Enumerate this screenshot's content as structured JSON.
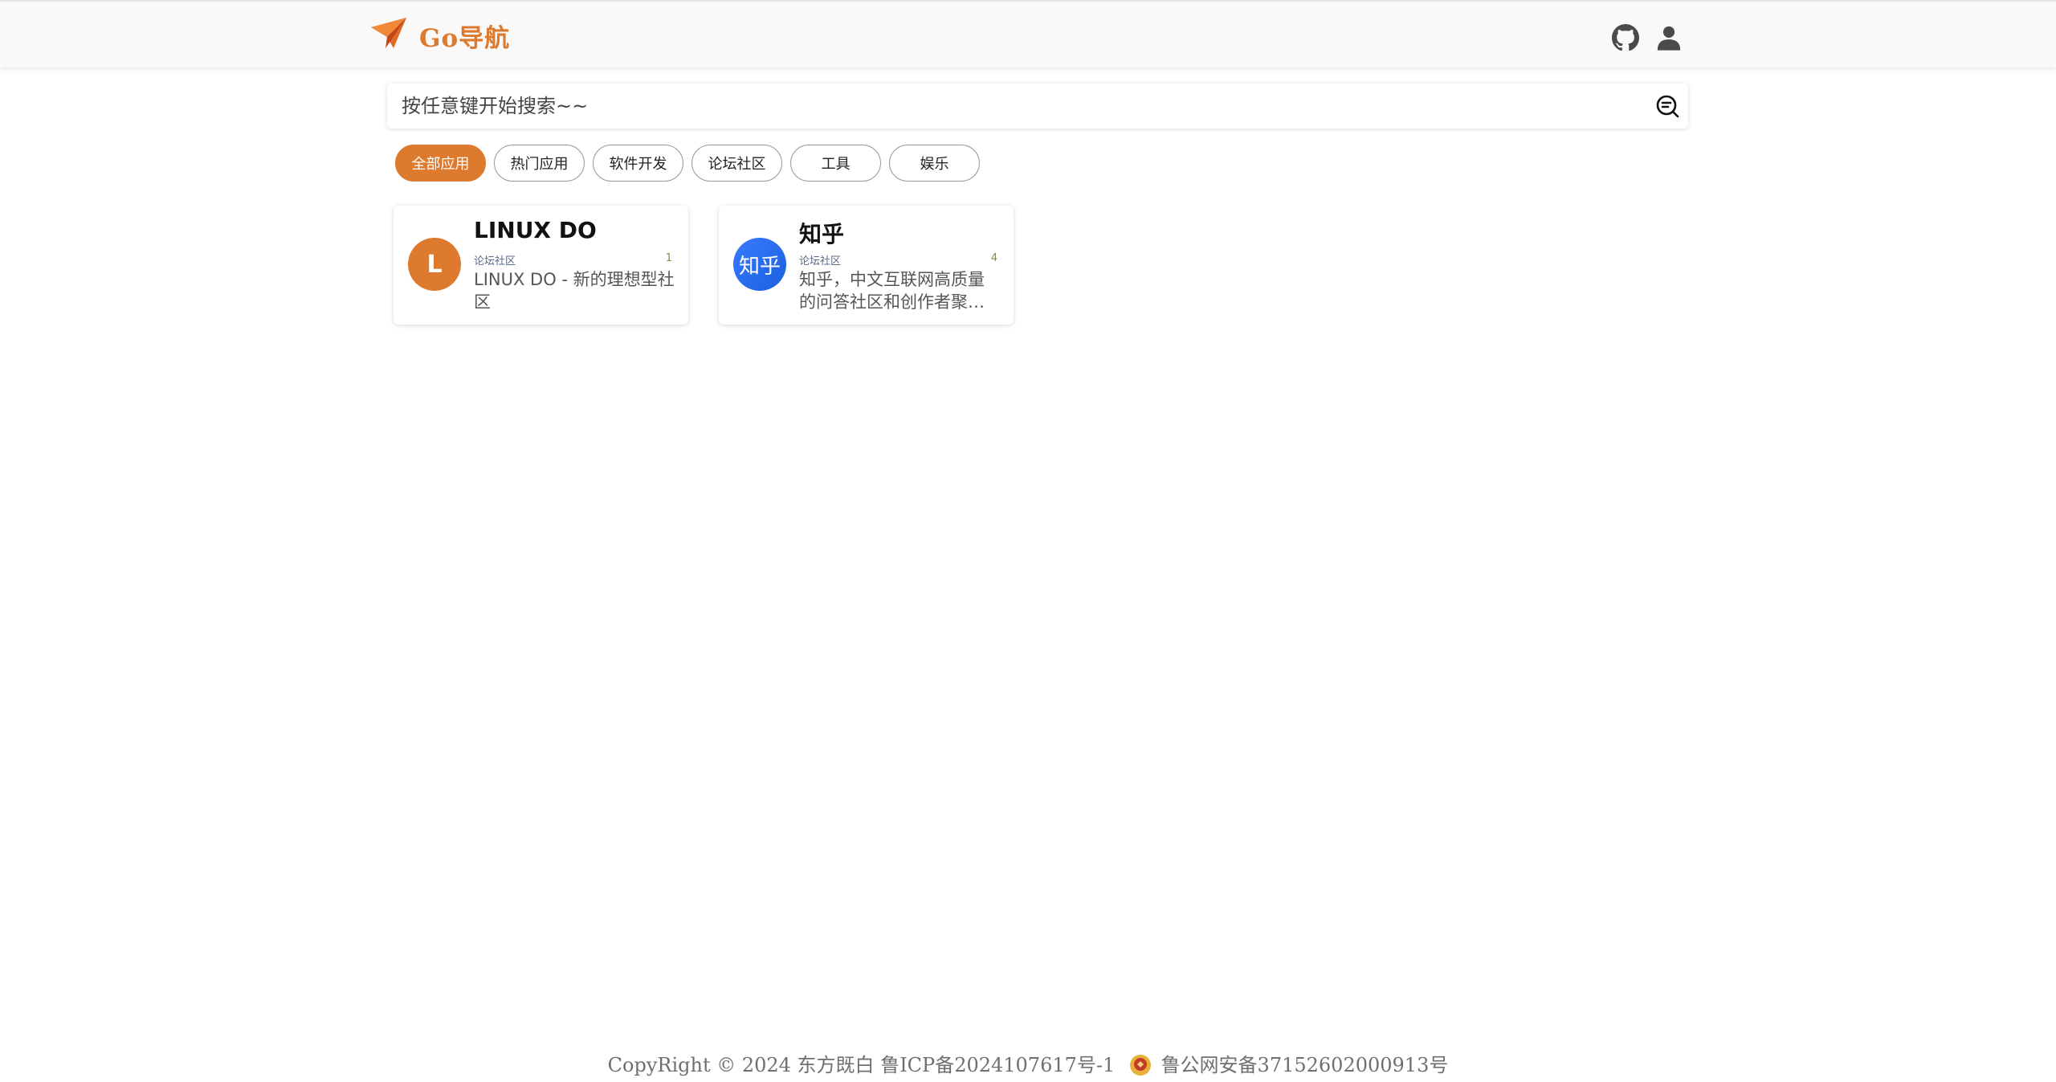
{
  "header": {
    "logo_text": "Go导航",
    "brand_color": "#dd7a2e",
    "github_icon": "github-icon",
    "user_icon": "user-icon"
  },
  "search": {
    "placeholder": "按任意键开始搜索~~",
    "value": "",
    "icon": "search-chat-icon"
  },
  "categories": [
    {
      "label": "全部应用",
      "active": true
    },
    {
      "label": "热门应用",
      "active": false
    },
    {
      "label": "软件开发",
      "active": false
    },
    {
      "label": "论坛社区",
      "active": false
    },
    {
      "label": "工具",
      "active": false
    },
    {
      "label": "娱乐",
      "active": false
    }
  ],
  "cards": [
    {
      "title": "LINUX DO",
      "avatar_text": "L",
      "avatar_color": "#dd7a2e",
      "tag": "论坛社区",
      "count": "1",
      "description": "LINUX DO - 新的理想型社区"
    },
    {
      "title": "知乎",
      "avatar_text": "知乎",
      "avatar_color": "#1a6cf2",
      "tag": "论坛社区",
      "count": "4",
      "description": "知乎，中文互联网高质量的问答社区和创作者聚集的原创内容平台"
    }
  ],
  "footer": {
    "copyright": "CopyRight © 2024 东方既白",
    "icp": "鲁ICP备2024107617号-1",
    "police": "鲁公网安备37152602000913号"
  }
}
